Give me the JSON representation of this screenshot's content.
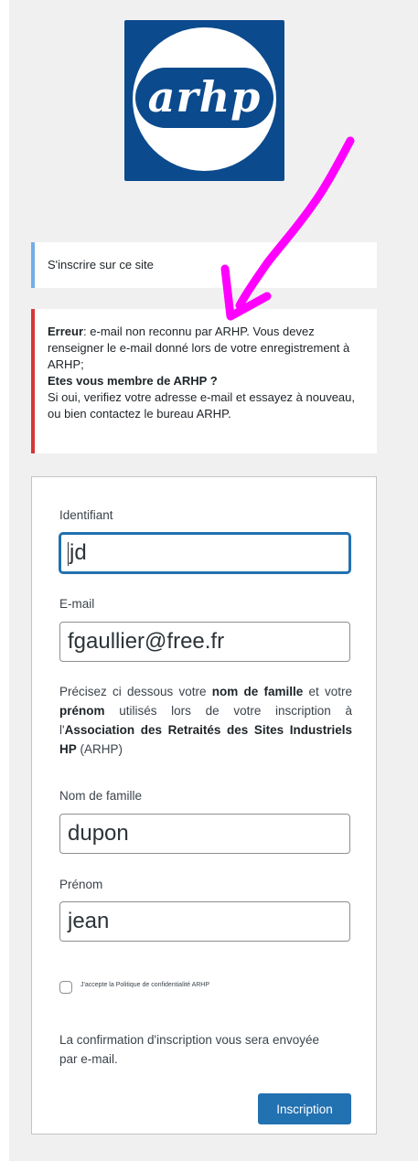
{
  "logo": {
    "text": "arhp"
  },
  "notice": {
    "text": "S'inscrire sur ce site"
  },
  "error": {
    "label": "Erreur",
    "message": ": e-mail non reconnu par ARHP. Vous devez renseigner le e-mail donné lors de votre enregistrement à ARHP;",
    "question": "Etes vous membre de ARHP ?",
    "hint": "Si oui, verifiez votre adresse e-mail et essayez à nouveau, ou bien contactez le bureau ARHP."
  },
  "form": {
    "username": {
      "label": "Identifiant",
      "value": "jd"
    },
    "email": {
      "label": "E-mail",
      "value": "fgaullier@free.fr"
    },
    "info": {
      "t1": "Précisez ci dessous votre ",
      "b1": "nom de famille",
      "t2": " et votre ",
      "b2": "prénom",
      "t3": " utilisés lors de votre inscription à l'",
      "b3": "Association des Retraités des Sites Industriels HP",
      "t4": " (ARHP)"
    },
    "lastname": {
      "label": "Nom de famille",
      "value": "dupon"
    },
    "firstname": {
      "label": "Prénom",
      "value": "jean"
    },
    "consent": {
      "label": "J'accepte la Politique de confidentialité ARHP",
      "checked": false
    },
    "confirmation": "La confirmation d'inscription vous sera envoyée par e-mail.",
    "submit_label": "Inscription"
  },
  "colors": {
    "primary": "#2271b1",
    "error": "#d63638",
    "notice": "#72aee6",
    "logo": "#0b4a8d",
    "annotation": "#ff00ff"
  }
}
